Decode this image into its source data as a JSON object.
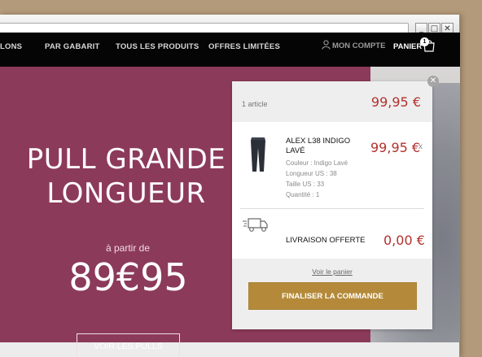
{
  "browser": {
    "window_controls": {
      "minimize": "_",
      "maximize": "□",
      "close": "✕"
    }
  },
  "nav": {
    "items": [
      "LONS",
      "PAR GABARIT",
      "TOUS LES PRODUITS",
      "OFFRES LIMITÉES"
    ],
    "account_label": "MON COMPTE",
    "cart_label": "PANIER",
    "cart_count": "1"
  },
  "hero": {
    "title_line1": "PULL GRANDE",
    "title_line2": "LONGUEUR",
    "from_label": "à partir de",
    "price": "89€95",
    "button_label": "VOIR LES PULLS"
  },
  "cart_dropdown": {
    "close_glyph": "✕",
    "count_label": "1 article",
    "total": "99,95 €",
    "item": {
      "name": "ALEX L38 INDIGO LAVÉ",
      "attrs": [
        "Couleur : Indigo Lavé",
        "Longueur US : 38",
        "Taille US : 33",
        "Quantité : 1"
      ],
      "price": "99,95 €",
      "remove": "x"
    },
    "shipping_label": "LIVRAISON OFFERTE",
    "shipping_price": "0,00 €",
    "view_cart": "Voir le panier",
    "checkout_label": "FINALISER LA COMMANDE"
  },
  "colors": {
    "hero_bg": "#8c3a5a",
    "price_red": "#b3312e",
    "checkout_gold": "#b48a3a",
    "nav_bg": "#050505"
  }
}
